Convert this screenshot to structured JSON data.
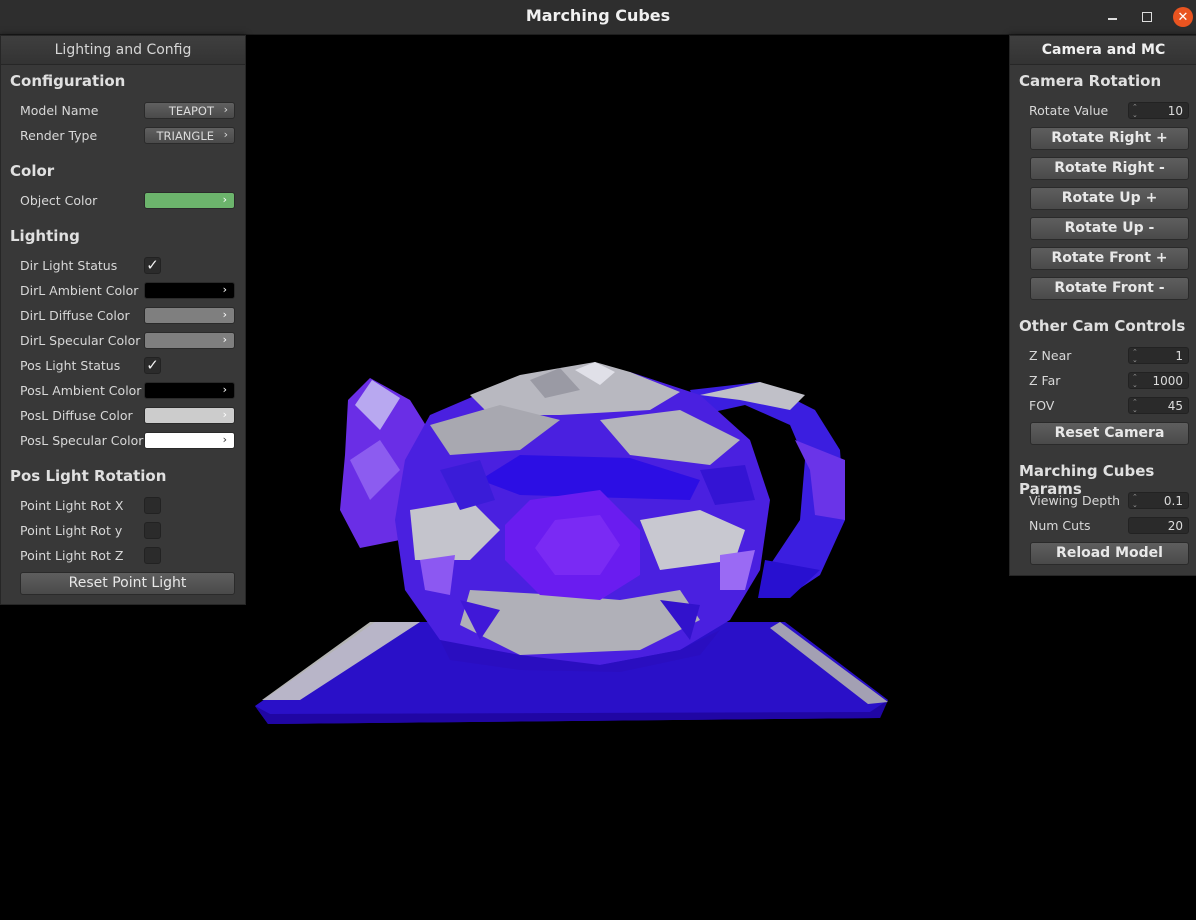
{
  "window": {
    "title": "Marching Cubes"
  },
  "left_panel": {
    "header": "Lighting and Config",
    "configuration": {
      "title": "Configuration",
      "model_name_label": "Model Name",
      "model_name_value": "TEAPOT",
      "render_type_label": "Render Type",
      "render_type_value": "TRIANGLE"
    },
    "color": {
      "title": "Color",
      "object_color_label": "Object Color",
      "object_color": "#6cb46c"
    },
    "lighting": {
      "title": "Lighting",
      "dir_light_status_label": "Dir Light Status",
      "dir_light_status": true,
      "dirl_ambient_label": "DirL Ambient Color",
      "dirl_ambient_color": "#000000",
      "dirl_diffuse_label": "DirL Diffuse Color",
      "dirl_diffuse_color": "#7f7f7f",
      "dirl_specular_label": "DirL Specular Color",
      "dirl_specular_color": "#7f7f7f",
      "pos_light_status_label": "Pos Light Status",
      "pos_light_status": true,
      "posl_ambient_label": "PosL Ambient Color",
      "posl_ambient_color": "#000000",
      "posl_diffuse_label": "PosL Diffuse Color",
      "posl_diffuse_color": "#cccccc",
      "posl_specular_label": "PosL Specular Color",
      "posl_specular_color": "#ffffff"
    },
    "pos_light_rotation": {
      "title": "Pos Light Rotation",
      "rot_x_label": "Point Light Rot X",
      "rot_x": false,
      "rot_y_label": "Point Light Rot y",
      "rot_y": false,
      "rot_z_label": "Point Light Rot Z",
      "rot_z": false,
      "reset_label": "Reset Point Light"
    }
  },
  "right_panel": {
    "header": "Camera and MC",
    "camera_rotation": {
      "title": "Camera Rotation",
      "rotate_value_label": "Rotate Value",
      "rotate_value": "10",
      "buttons": [
        "Rotate Right +",
        "Rotate Right -",
        "Rotate Up +",
        "Rotate Up -",
        "Rotate Front +",
        "Rotate Front -"
      ]
    },
    "other_cam": {
      "title": "Other Cam Controls",
      "z_near_label": "Z Near",
      "z_near": "1",
      "z_far_label": "Z Far",
      "z_far": "1000",
      "fov_label": "FOV",
      "fov": "45",
      "reset_label": "Reset Camera"
    },
    "mc_params": {
      "title": "Marching Cubes Params",
      "viewing_depth_label": "Viewing Depth",
      "viewing_depth": "0.1",
      "num_cuts_label": "Num Cuts",
      "num_cuts": "20",
      "reload_label": "Reload Model"
    }
  },
  "icons": {
    "dropdown_arrow": "›",
    "check": "✓",
    "spin": "⌃⌄"
  }
}
